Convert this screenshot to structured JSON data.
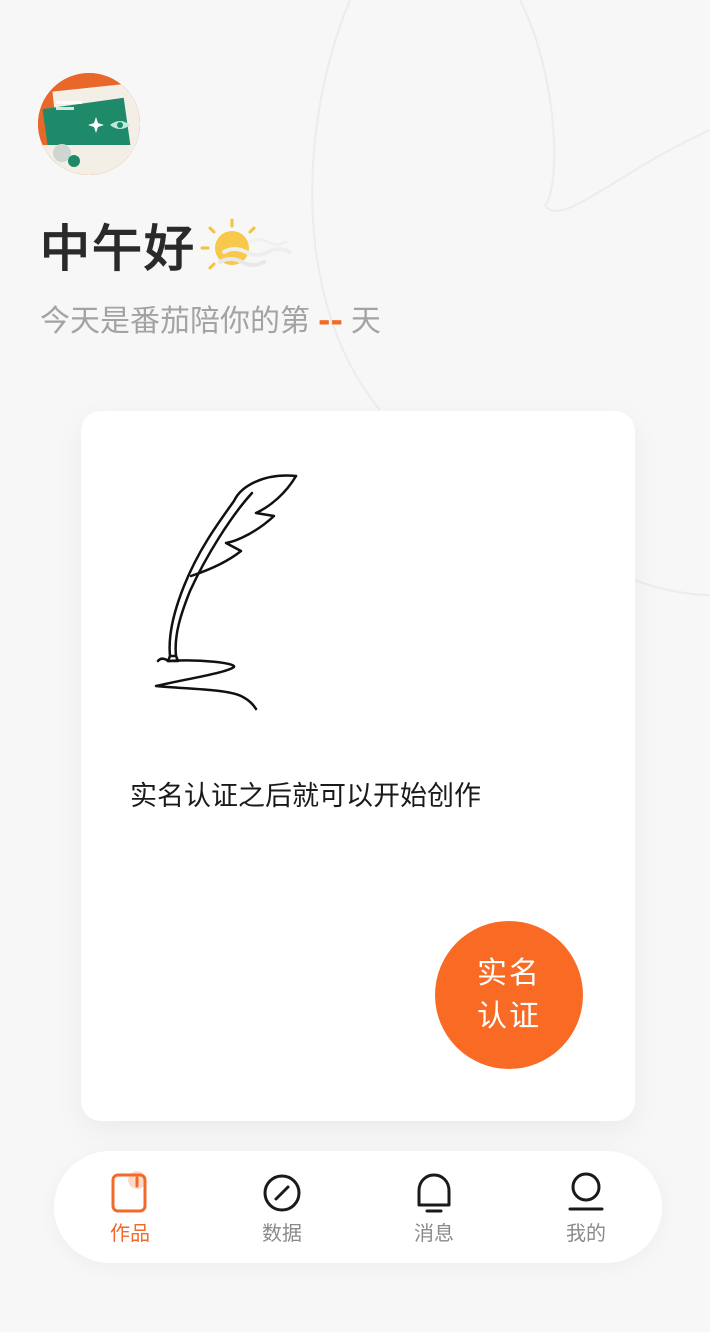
{
  "header": {
    "greeting": "中午好",
    "weather_icon": "sun-icon",
    "subtitle_prefix": "今天是番茄陪你的第",
    "days": "--",
    "subtitle_suffix": "天",
    "avatar_icon": "avatar-image"
  },
  "card": {
    "illustration": "quill-pen-icon",
    "message": "实名认证之后就可以开始创作",
    "verify_line1": "实名",
    "verify_line2": "认证"
  },
  "tabbar": {
    "items": [
      {
        "label": "作品",
        "icon": "works-icon",
        "active": true
      },
      {
        "label": "数据",
        "icon": "data-icon",
        "active": false
      },
      {
        "label": "消息",
        "icon": "message-icon",
        "active": false
      },
      {
        "label": "我的",
        "icon": "profile-icon",
        "active": false
      }
    ]
  },
  "colors": {
    "accent": "#f96a24",
    "text_dark": "#1a1a1a",
    "text_muted": "#a3a3a3",
    "background": "#f7f7f7"
  }
}
